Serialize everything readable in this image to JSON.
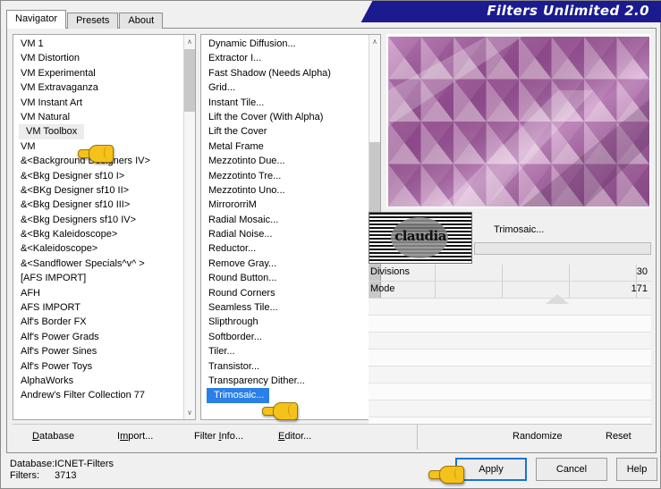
{
  "window": {
    "title": "Filters Unlimited 2.0"
  },
  "tabs": [
    {
      "label": "Navigator",
      "active": true
    },
    {
      "label": "Presets",
      "active": false
    },
    {
      "label": "About",
      "active": false
    }
  ],
  "categories": {
    "items": [
      "VM 1",
      "VM Distortion",
      "VM Experimental",
      "VM Extravaganza",
      "VM Instant Art",
      "VM Natural",
      "VM Toolbox",
      "VM",
      "&<Background Designers IV>",
      "&<Bkg Designer sf10 I>",
      "&<BKg Designer sf10 II>",
      "&<Bkg Designer sf10 III>",
      "&<Bkg Designers sf10 IV>",
      "&<Bkg Kaleidoscope>",
      "&<Kaleidoscope>",
      "&<Sandflower Specials^v^ >",
      "[AFS IMPORT]",
      "AFH",
      "AFS IMPORT",
      "Alf's Border FX",
      "Alf's Power Grads",
      "Alf's Power Sines",
      "Alf's Power Toys",
      "AlphaWorks",
      "Andrew's Filter Collection 77"
    ],
    "selected": "VM Toolbox"
  },
  "filters": {
    "items": [
      "Dynamic Diffusion...",
      "Extractor I...",
      "Fast Shadow (Needs Alpha)",
      "Grid...",
      "Instant Tile...",
      "Lift the Cover (With Alpha)",
      "Lift the Cover",
      "Metal Frame",
      "Mezzotinto Due...",
      "Mezzotinto Tre...",
      "Mezzotinto Uno...",
      "MirrororriM",
      "Radial Mosaic...",
      "Radial Noise...",
      "Reductor...",
      "Remove Gray...",
      "Round Button...",
      "Round Corners",
      "Seamless Tile...",
      "Slipthrough",
      "Softborder...",
      "Tiler...",
      "Transistor...",
      "Transparency Dither...",
      "Trimosaic..."
    ],
    "selected": "Trimosaic..."
  },
  "filter_panel": {
    "name": "Trimosaic...",
    "logo_text": "claudia",
    "parameters": [
      {
        "label": "Divisions",
        "value": "30"
      },
      {
        "label": "Mode",
        "value": "171"
      }
    ]
  },
  "link_bar": {
    "left": [
      {
        "label": "Database",
        "accel": "D"
      },
      {
        "label": "Import...",
        "accel": "m"
      },
      {
        "label": "Filter Info...",
        "accel": "I"
      },
      {
        "label": "Editor...",
        "accel": "E"
      }
    ],
    "right": [
      {
        "label": "Randomize"
      },
      {
        "label": "Reset"
      }
    ]
  },
  "status": {
    "database_label": "Database:",
    "database_value": "ICNET-Filters",
    "filters_label": "Filters:",
    "filters_value": "3713"
  },
  "dialog_buttons": {
    "apply": "Apply",
    "cancel": "Cancel",
    "help": "Help"
  },
  "colors": {
    "banner": "#1b1b8f",
    "selection_blue": "#2a7fe8",
    "apply_focus": "#1673d6",
    "hand_yellow": "#f5c21b"
  },
  "scroll_icons": {
    "up": "∧",
    "down": "∨"
  }
}
